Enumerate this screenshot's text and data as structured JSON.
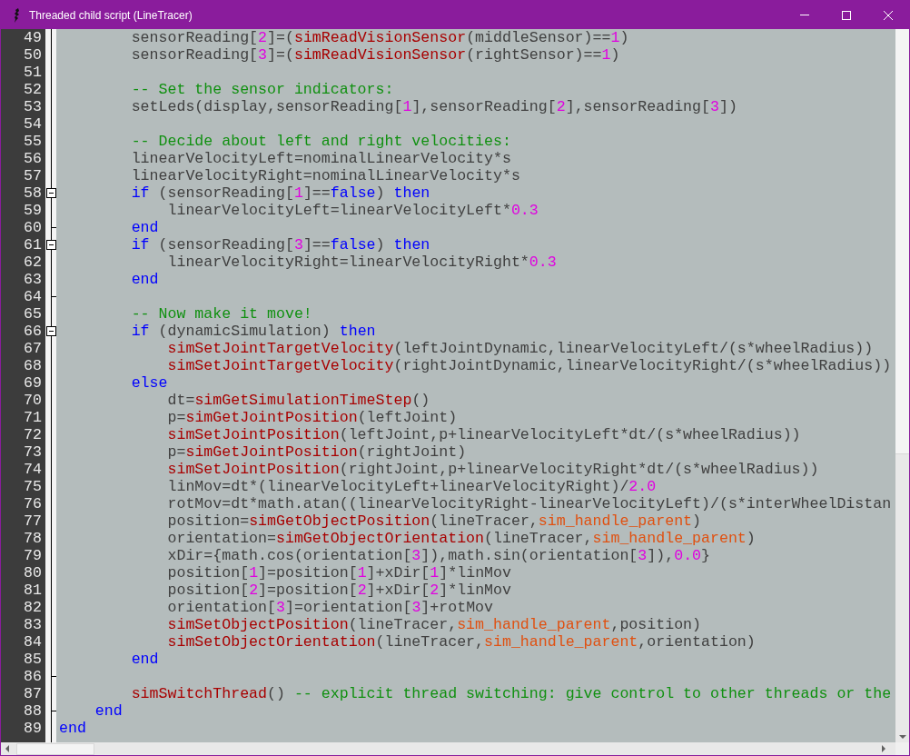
{
  "window": {
    "title": "Threaded child script (LineTracer)"
  },
  "lines": [
    {
      "number": "49",
      "kind": "code",
      "tokens": [
        {
          "kind": "plain",
          "text": "        sensorReading["
        },
        {
          "kind": "number",
          "text": "2"
        },
        {
          "kind": "plain",
          "text": "]=("
        },
        {
          "kind": "function",
          "text": "simReadVisionSensor"
        },
        {
          "kind": "plain",
          "text": "(middleSensor)=="
        },
        {
          "kind": "number",
          "text": "1"
        },
        {
          "kind": "plain",
          "text": ")"
        }
      ]
    },
    {
      "number": "50",
      "kind": "code",
      "tokens": [
        {
          "kind": "plain",
          "text": "        sensorReading["
        },
        {
          "kind": "number",
          "text": "3"
        },
        {
          "kind": "plain",
          "text": "]=("
        },
        {
          "kind": "function",
          "text": "simReadVisionSensor"
        },
        {
          "kind": "plain",
          "text": "(rightSensor)=="
        },
        {
          "kind": "number",
          "text": "1"
        },
        {
          "kind": "plain",
          "text": ")"
        }
      ]
    },
    {
      "number": "51",
      "kind": "code"
    },
    {
      "number": "52",
      "kind": "code",
      "tokens": [
        {
          "kind": "comment",
          "text": "        -- Set the sensor indicators:"
        }
      ]
    },
    {
      "number": "53",
      "kind": "code",
      "tokens": [
        {
          "kind": "plain",
          "text": "        setLeds(display,sensorReading["
        },
        {
          "kind": "number",
          "text": "1"
        },
        {
          "kind": "plain",
          "text": "],sensorReading["
        },
        {
          "kind": "number",
          "text": "2"
        },
        {
          "kind": "plain",
          "text": "],sensorReading["
        },
        {
          "kind": "number",
          "text": "3"
        },
        {
          "kind": "plain",
          "text": "])"
        }
      ]
    },
    {
      "number": "54",
      "kind": "code"
    },
    {
      "number": "55",
      "kind": "code",
      "tokens": [
        {
          "kind": "comment",
          "text": "        -- Decide about left and right velocities:"
        }
      ]
    },
    {
      "number": "56",
      "kind": "code",
      "tokens": [
        {
          "kind": "plain",
          "text": "        linearVelocityLeft=nominalLinearVelocity*s"
        }
      ]
    },
    {
      "number": "57",
      "kind": "code",
      "tokens": [
        {
          "kind": "plain",
          "text": "        linearVelocityRight=nominalLinearVelocity*s"
        }
      ]
    },
    {
      "number": "58",
      "kind": "foldstart",
      "tokens": [
        {
          "kind": "keyword",
          "text": "        if"
        },
        {
          "kind": "plain",
          "text": " (sensorReading["
        },
        {
          "kind": "number",
          "text": "1"
        },
        {
          "kind": "plain",
          "text": "]=="
        },
        {
          "kind": "keyword",
          "text": "false"
        },
        {
          "kind": "plain",
          "text": ") "
        },
        {
          "kind": "keyword",
          "text": "then"
        }
      ]
    },
    {
      "number": "59",
      "kind": "code",
      "tokens": [
        {
          "kind": "plain",
          "text": "            linearVelocityLeft=linearVelocityLeft*"
        },
        {
          "kind": "number",
          "text": "0.3"
        }
      ]
    },
    {
      "number": "60",
      "kind": "foldend",
      "tokens": [
        {
          "kind": "keyword",
          "text": "        end"
        }
      ]
    },
    {
      "number": "61",
      "kind": "foldstart",
      "tokens": [
        {
          "kind": "keyword",
          "text": "        if"
        },
        {
          "kind": "plain",
          "text": " (sensorReading["
        },
        {
          "kind": "number",
          "text": "3"
        },
        {
          "kind": "plain",
          "text": "]=="
        },
        {
          "kind": "keyword",
          "text": "false"
        },
        {
          "kind": "plain",
          "text": ") "
        },
        {
          "kind": "keyword",
          "text": "then"
        }
      ]
    },
    {
      "number": "62",
      "kind": "code",
      "tokens": [
        {
          "kind": "plain",
          "text": "            linearVelocityRight=linearVelocityRight*"
        },
        {
          "kind": "number",
          "text": "0.3"
        }
      ]
    },
    {
      "number": "63",
      "kind": "code",
      "tokens": [
        {
          "kind": "keyword",
          "text": "        end"
        }
      ]
    },
    {
      "number": "64",
      "kind": "foldend"
    },
    {
      "number": "65",
      "kind": "code",
      "tokens": [
        {
          "kind": "comment",
          "text": "        -- Now make it move!"
        }
      ]
    },
    {
      "number": "66",
      "kind": "foldstart",
      "tokens": [
        {
          "kind": "keyword",
          "text": "        if"
        },
        {
          "kind": "plain",
          "text": " (dynamicSimulation) "
        },
        {
          "kind": "keyword",
          "text": "then"
        }
      ]
    },
    {
      "number": "67",
      "kind": "code",
      "tokens": [
        {
          "kind": "function",
          "text": "            simSetJointTargetVelocity"
        },
        {
          "kind": "plain",
          "text": "(leftJointDynamic,linearVelocityLeft/(s*wheelRadius))"
        }
      ]
    },
    {
      "number": "68",
      "kind": "code",
      "tokens": [
        {
          "kind": "function",
          "text": "            simSetJointTargetVelocity"
        },
        {
          "kind": "plain",
          "text": "(rightJointDynamic,linearVelocityRight/(s*wheelRadius))"
        }
      ]
    },
    {
      "number": "69",
      "kind": "code",
      "tokens": [
        {
          "kind": "keyword",
          "text": "        else"
        }
      ]
    },
    {
      "number": "70",
      "kind": "code",
      "tokens": [
        {
          "kind": "plain",
          "text": "            dt="
        },
        {
          "kind": "function",
          "text": "simGetSimulationTimeStep"
        },
        {
          "kind": "plain",
          "text": "()"
        }
      ]
    },
    {
      "number": "71",
      "kind": "code",
      "tokens": [
        {
          "kind": "plain",
          "text": "            p="
        },
        {
          "kind": "function",
          "text": "simGetJointPosition"
        },
        {
          "kind": "plain",
          "text": "(leftJoint)"
        }
      ]
    },
    {
      "number": "72",
      "kind": "code",
      "tokens": [
        {
          "kind": "function",
          "text": "            simSetJointPosition"
        },
        {
          "kind": "plain",
          "text": "(leftJoint,p+linearVelocityLeft*dt/(s*wheelRadius))"
        }
      ]
    },
    {
      "number": "73",
      "kind": "code",
      "tokens": [
        {
          "kind": "plain",
          "text": "            p="
        },
        {
          "kind": "function",
          "text": "simGetJointPosition"
        },
        {
          "kind": "plain",
          "text": "(rightJoint)"
        }
      ]
    },
    {
      "number": "74",
      "kind": "code",
      "tokens": [
        {
          "kind": "function",
          "text": "            simSetJointPosition"
        },
        {
          "kind": "plain",
          "text": "(rightJoint,p+linearVelocityRight*dt/(s*wheelRadius))"
        }
      ]
    },
    {
      "number": "75",
      "kind": "code",
      "tokens": [
        {
          "kind": "plain",
          "text": "            linMov=dt*(linearVelocityLeft+linearVelocityRight)/"
        },
        {
          "kind": "number",
          "text": "2.0"
        }
      ]
    },
    {
      "number": "76",
      "kind": "code",
      "tokens": [
        {
          "kind": "plain",
          "text": "            rotMov=dt*math.atan((linearVelocityRight-linearVelocityLeft)/(s*interWheelDistan"
        }
      ]
    },
    {
      "number": "77",
      "kind": "code",
      "tokens": [
        {
          "kind": "plain",
          "text": "            position="
        },
        {
          "kind": "function",
          "text": "simGetObjectPosition"
        },
        {
          "kind": "plain",
          "text": "(lineTracer,"
        },
        {
          "kind": "constant",
          "text": "sim_handle_parent"
        },
        {
          "kind": "plain",
          "text": ")"
        }
      ]
    },
    {
      "number": "78",
      "kind": "code",
      "tokens": [
        {
          "kind": "plain",
          "text": "            orientation="
        },
        {
          "kind": "function",
          "text": "simGetObjectOrientation"
        },
        {
          "kind": "plain",
          "text": "(lineTracer,"
        },
        {
          "kind": "constant",
          "text": "sim_handle_parent"
        },
        {
          "kind": "plain",
          "text": ")"
        }
      ]
    },
    {
      "number": "79",
      "kind": "code",
      "tokens": [
        {
          "kind": "plain",
          "text": "            xDir={math.cos(orientation["
        },
        {
          "kind": "number",
          "text": "3"
        },
        {
          "kind": "plain",
          "text": "]),math.sin(orientation["
        },
        {
          "kind": "number",
          "text": "3"
        },
        {
          "kind": "plain",
          "text": "]),"
        },
        {
          "kind": "number",
          "text": "0.0"
        },
        {
          "kind": "plain",
          "text": "}"
        }
      ]
    },
    {
      "number": "80",
      "kind": "code",
      "tokens": [
        {
          "kind": "plain",
          "text": "            position["
        },
        {
          "kind": "number",
          "text": "1"
        },
        {
          "kind": "plain",
          "text": "]=position["
        },
        {
          "kind": "number",
          "text": "1"
        },
        {
          "kind": "plain",
          "text": "]+xDir["
        },
        {
          "kind": "number",
          "text": "1"
        },
        {
          "kind": "plain",
          "text": "]*linMov"
        }
      ]
    },
    {
      "number": "81",
      "kind": "code",
      "tokens": [
        {
          "kind": "plain",
          "text": "            position["
        },
        {
          "kind": "number",
          "text": "2"
        },
        {
          "kind": "plain",
          "text": "]=position["
        },
        {
          "kind": "number",
          "text": "2"
        },
        {
          "kind": "plain",
          "text": "]+xDir["
        },
        {
          "kind": "number",
          "text": "2"
        },
        {
          "kind": "plain",
          "text": "]*linMov"
        }
      ]
    },
    {
      "number": "82",
      "kind": "code",
      "tokens": [
        {
          "kind": "plain",
          "text": "            orientation["
        },
        {
          "kind": "number",
          "text": "3"
        },
        {
          "kind": "plain",
          "text": "]=orientation["
        },
        {
          "kind": "number",
          "text": "3"
        },
        {
          "kind": "plain",
          "text": "]+rotMov"
        }
      ]
    },
    {
      "number": "83",
      "kind": "code",
      "tokens": [
        {
          "kind": "function",
          "text": "            simSetObjectPosition"
        },
        {
          "kind": "plain",
          "text": "(lineTracer,"
        },
        {
          "kind": "constant",
          "text": "sim_handle_parent"
        },
        {
          "kind": "plain",
          "text": ",position)"
        }
      ]
    },
    {
      "number": "84",
      "kind": "code",
      "tokens": [
        {
          "kind": "function",
          "text": "            simSetObjectOrientation"
        },
        {
          "kind": "plain",
          "text": "(lineTracer,"
        },
        {
          "kind": "constant",
          "text": "sim_handle_parent"
        },
        {
          "kind": "plain",
          "text": ",orientation)"
        }
      ]
    },
    {
      "number": "85",
      "kind": "code",
      "tokens": [
        {
          "kind": "keyword",
          "text": "        end"
        }
      ]
    },
    {
      "number": "86",
      "kind": "foldend"
    },
    {
      "number": "87",
      "kind": "code",
      "tokens": [
        {
          "kind": "function",
          "text": "        simSwitchThread"
        },
        {
          "kind": "plain",
          "text": "() "
        },
        {
          "kind": "comment",
          "text": "-- explicit thread switching: give control to other threads or the"
        }
      ]
    },
    {
      "number": "88",
      "kind": "foldend",
      "tokens": [
        {
          "kind": "keyword",
          "text": "    end"
        }
      ]
    },
    {
      "number": "89",
      "kind": "code",
      "tokens": [
        {
          "kind": "keyword",
          "text": "end"
        }
      ]
    }
  ]
}
